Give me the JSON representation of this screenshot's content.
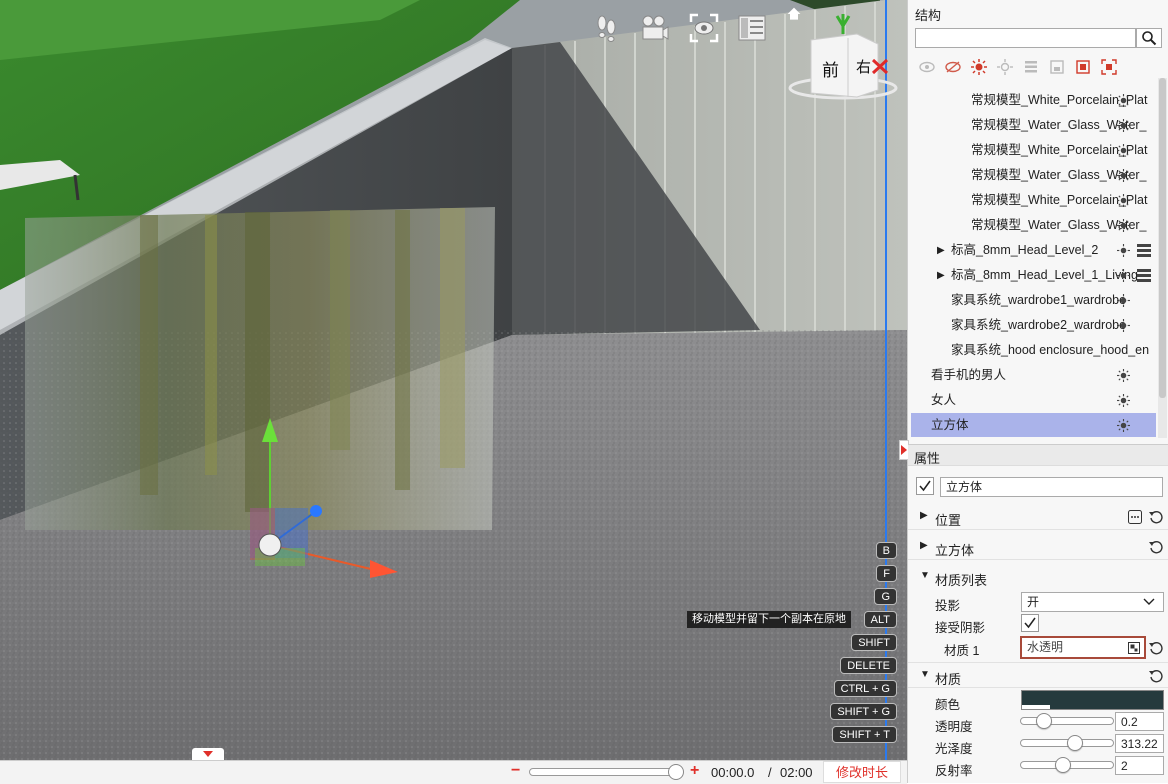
{
  "viewport": {
    "nav_cube": {
      "front_label": "前",
      "right_label": "右"
    },
    "toolbar_icons": [
      "footsteps-icon",
      "camera-icon",
      "focus-eye-icon",
      "panel-list-icon",
      "home-icon"
    ],
    "key_hints": [
      "B",
      "F",
      "G",
      "ALT",
      "SHIFT",
      "DELETE",
      "CTRL + G",
      "SHIFT + G",
      "SHIFT + T"
    ],
    "alt_tooltip": "移动模型并留下一个副本在原地"
  },
  "timeline": {
    "minus": "−",
    "plus": "+",
    "current_time": "00:00.0",
    "separator": "/",
    "total_time": "02:00",
    "edit_duration_label": "修改时长"
  },
  "structure": {
    "title": "结构",
    "search_placeholder": "",
    "items": [
      {
        "label": "常规模型_White_Porcelain_Plat",
        "indent": 2
      },
      {
        "label": "常规模型_Water_Glass_Water_",
        "indent": 2
      },
      {
        "label": "常规模型_White_Porcelain_Plat",
        "indent": 2
      },
      {
        "label": "常规模型_Water_Glass_Water_",
        "indent": 2
      },
      {
        "label": "常规模型_White_Porcelain_Plat",
        "indent": 2
      },
      {
        "label": "常规模型_Water_Glass_Water_",
        "indent": 2
      },
      {
        "label": "标高_8mm_Head_Level_2",
        "indent": 1,
        "expandable": true
      },
      {
        "label": "标高_8mm_Head_Level_1_Living",
        "indent": 1,
        "expandable": true
      },
      {
        "label": "家具系统_wardrobe1_wardrobe",
        "indent": 1
      },
      {
        "label": "家具系统_wardrobe2_wardrobe",
        "indent": 1
      },
      {
        "label": "家具系统_hood enclosure_hood_en",
        "indent": 1
      },
      {
        "label": "看手机的男人",
        "indent": 0
      },
      {
        "label": "女人",
        "indent": 0
      },
      {
        "label": "立方体",
        "indent": 0,
        "selected": true
      }
    ]
  },
  "properties": {
    "title": "属性",
    "object_name": "立方体",
    "sections": {
      "position": "位置",
      "cube": "立方体",
      "material_list": "材质列表",
      "material": "材质"
    },
    "material_list": {
      "shadow_label": "投影",
      "shadow_value": "开",
      "receive_shadow_label": "接受阴影",
      "material1_label": "材质 1",
      "material1_value": "水透明"
    },
    "material": {
      "color_label": "颜色",
      "color_value": "#253a3d",
      "opacity_label": "透明度",
      "opacity_value": "0.2",
      "opacity_level": 0.2,
      "gloss_label": "光泽度",
      "gloss_value": "313.22",
      "gloss_level": 0.6,
      "reflectivity_label": "反射率",
      "reflectivity_value": "2",
      "reflectivity_level": 0.45
    }
  }
}
